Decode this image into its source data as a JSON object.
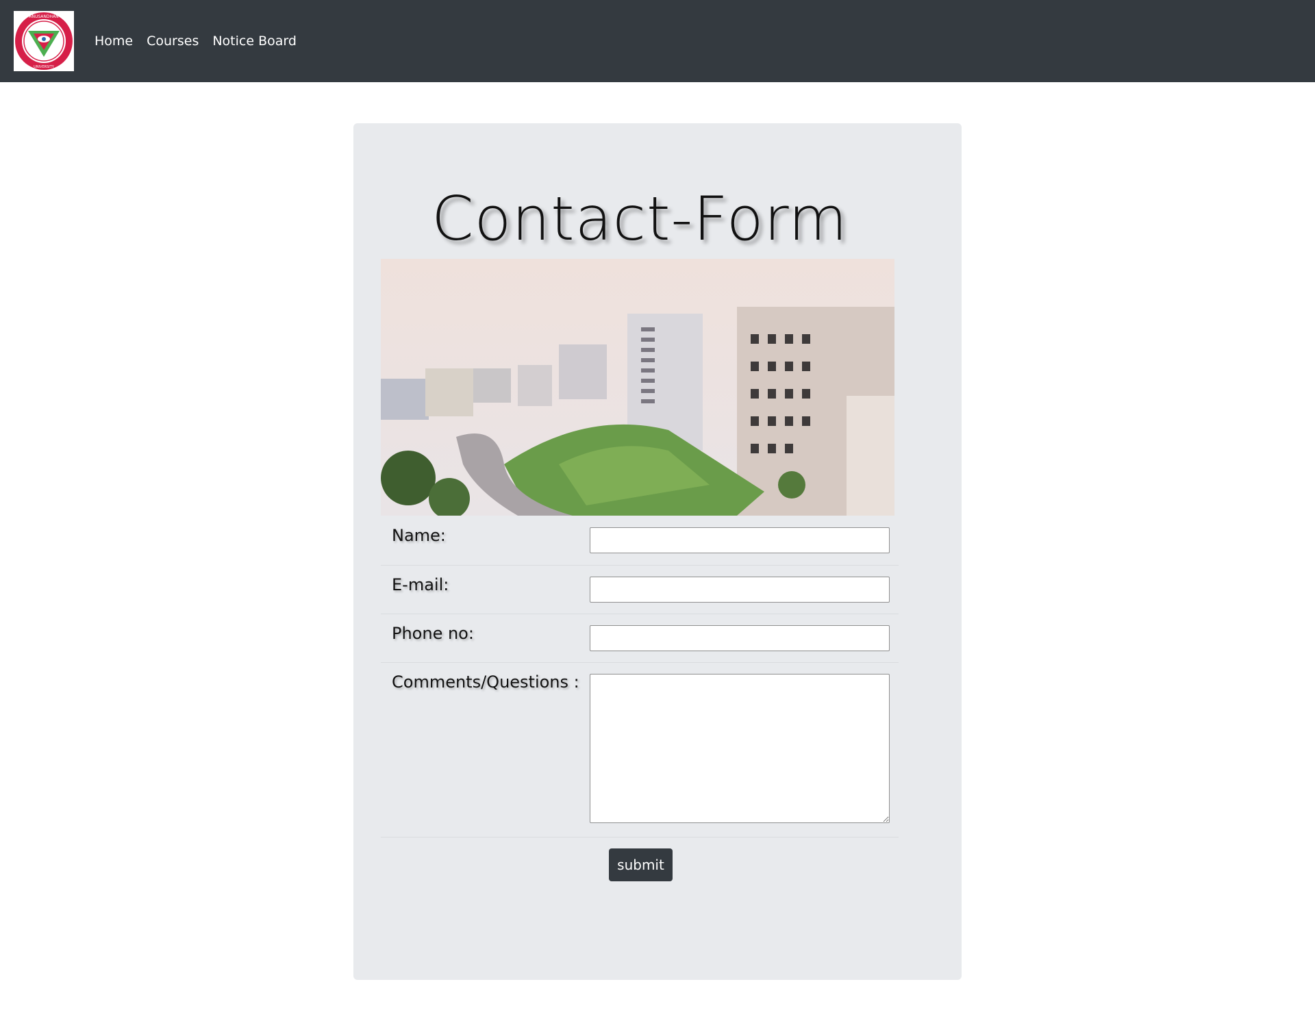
{
  "nav": {
    "logo_text": "SIKSHA 'O' ANUSANDHAN (DEEMED TO BE UNIVERSITY)",
    "links": [
      "Home",
      "Courses",
      "Notice Board"
    ]
  },
  "form": {
    "title": "Contact-Form",
    "image_alt": "campus-photo",
    "fields": {
      "name": {
        "label": "Name:",
        "value": ""
      },
      "email": {
        "label": "E-mail:",
        "value": ""
      },
      "phone": {
        "label": "Phone no:",
        "value": ""
      },
      "comments": {
        "label": "Comments/Questions :",
        "value": ""
      }
    },
    "submit_label": "submit"
  },
  "colors": {
    "navbar": "#343a40",
    "card": "#e8eaed",
    "button": "#343a40",
    "logo_red": "#d61f48",
    "logo_green": "#4caf50"
  }
}
